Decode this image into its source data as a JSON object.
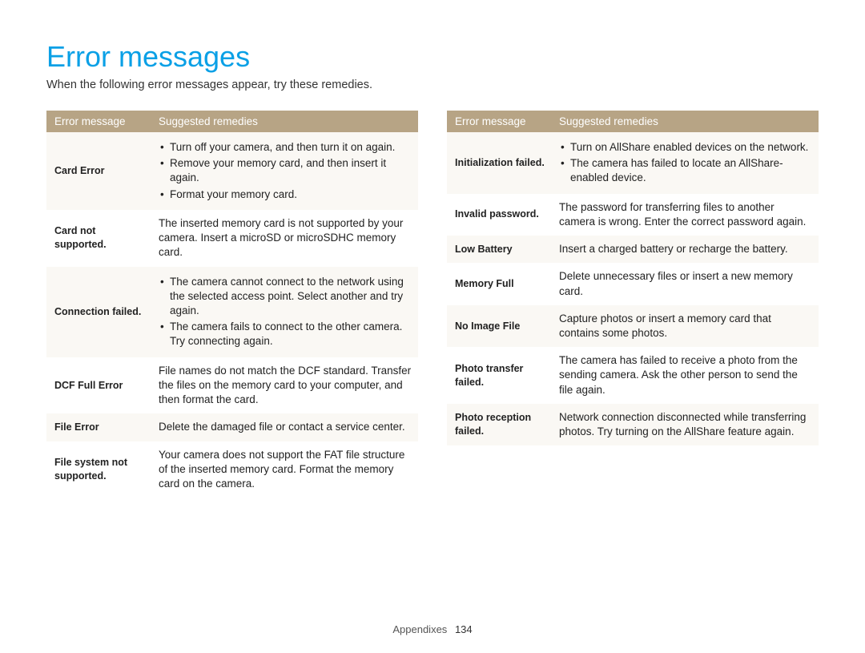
{
  "title": "Error messages",
  "intro": "When the following error messages appear, try these remedies.",
  "headers": {
    "msg": "Error message",
    "rem": "Suggested remedies"
  },
  "left": [
    {
      "msg": "Card Error",
      "bullets": [
        "Turn off your camera, and then turn it on again.",
        "Remove your memory card, and then insert it again.",
        "Format your memory card."
      ]
    },
    {
      "msg": "Card not supported.",
      "text": "The inserted memory card is not supported by your camera. Insert a microSD or microSDHC memory card."
    },
    {
      "msg": "Connection failed.",
      "bullets": [
        "The camera cannot connect to the network using the selected access point. Select another and try again.",
        "The camera fails to connect to the other camera. Try connecting again."
      ]
    },
    {
      "msg": "DCF Full Error",
      "text": "File names do not match the DCF standard. Transfer the files on the memory card to your computer, and then format the card."
    },
    {
      "msg": "File Error",
      "text": "Delete the damaged file or contact a service center."
    },
    {
      "msg": "File system not supported.",
      "text": "Your camera does not support the FAT file structure of the inserted memory card. Format the memory card on the camera."
    }
  ],
  "right": [
    {
      "msg": "Initialization failed.",
      "bullets": [
        "Turn on AllShare enabled devices on the network.",
        "The camera has failed to locate an AllShare-enabled device."
      ]
    },
    {
      "msg": "Invalid password.",
      "text": "The password for transferring files to another camera is wrong. Enter the correct password again."
    },
    {
      "msg": "Low Battery",
      "text": "Insert a charged battery or recharge the battery."
    },
    {
      "msg": "Memory Full",
      "text": "Delete unnecessary files or insert a new memory card."
    },
    {
      "msg": "No Image File",
      "text": "Capture photos or insert a memory card that contains some photos."
    },
    {
      "msg": "Photo transfer failed.",
      "text": "The camera has failed to receive a photo from the sending camera. Ask the other person to send the file again."
    },
    {
      "msg": "Photo reception failed.",
      "text": "Network connection disconnected while transferring photos. Try turning on the AllShare feature again."
    }
  ],
  "footer": {
    "section": "Appendixes",
    "page": "134"
  }
}
